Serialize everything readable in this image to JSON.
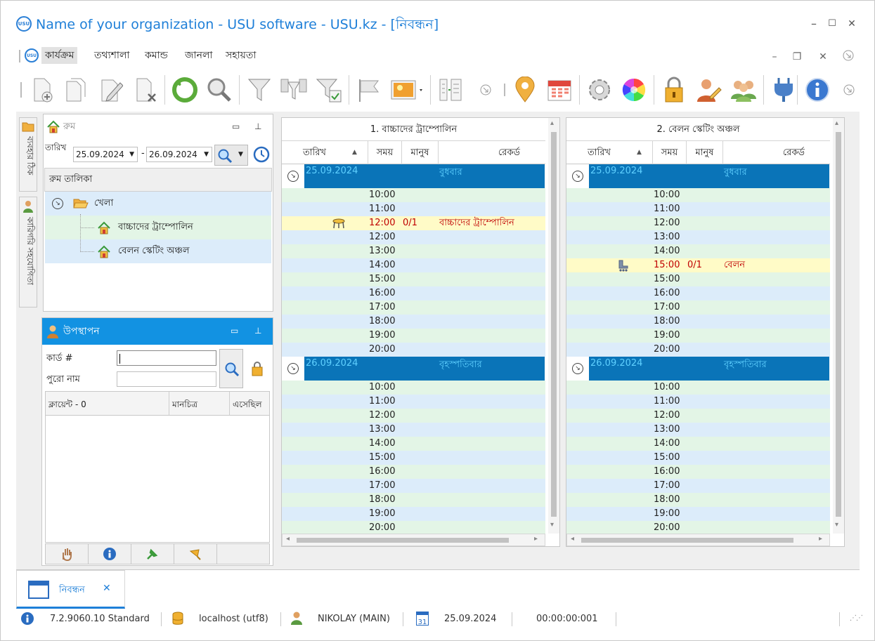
{
  "window": {
    "logo_text": "USU",
    "title": "Name of your organization - USU software - USU.kz - [নিবন্ধন]",
    "min_glyph": "–",
    "max_glyph": "☐",
    "close_glyph": "✕"
  },
  "menu": {
    "items": [
      "কার্যক্রম",
      "তথ্যশালা",
      "কমান্ড",
      "জানলা",
      "সহায়তা"
    ],
    "mdi_min": "–",
    "mdi_restore": "❐",
    "mdi_close": "✕"
  },
  "side_tabs": {
    "list_label": "ব্যবহার ঠিক",
    "staff_label": "কারিগরি সহযোগিতা"
  },
  "room_panel": {
    "title": "রুম",
    "date_label": "তারিখ",
    "date_from": "25.09.2024",
    "date_dash": "-",
    "date_to": "26.09.2024",
    "list_header": "রুম তালিকা",
    "tree": {
      "root": "খেলা",
      "children": [
        "বাচ্চাদের ট্রাম্পোলিন",
        "বেলন স্কেটিং অঞ্চল"
      ]
    }
  },
  "attendance_panel": {
    "title": "উপস্থাপন",
    "card_label": "কার্ড #",
    "card_value": "",
    "name_label": "পুরো নাম",
    "name_value": "",
    "col_client": "ক্লায়েন্ট - 0",
    "col_photo": "মানচিত্র",
    "col_came": "এসেছিল"
  },
  "grid_columns": {
    "date": "তারিখ",
    "time": "সময়",
    "people": "মানুষ",
    "record": "রেকর্ড"
  },
  "schedules": [
    {
      "title": "1. বাচ্চাদের ট্রাম্পোলিন",
      "days": [
        {
          "date": "25.09.2024",
          "weekday": "বুধবার",
          "slots": [
            {
              "time": "10:00"
            },
            {
              "time": "11:00"
            },
            {
              "time": "12:00",
              "people": "0/1",
              "record": "বাচ্চাদের ট্রাম্পোলিন",
              "icon": "trampoline-icon"
            },
            {
              "time": "12:00"
            },
            {
              "time": "13:00"
            },
            {
              "time": "14:00"
            },
            {
              "time": "15:00"
            },
            {
              "time": "16:00"
            },
            {
              "time": "17:00"
            },
            {
              "time": "18:00"
            },
            {
              "time": "19:00"
            },
            {
              "time": "20:00"
            }
          ]
        },
        {
          "date": "26.09.2024",
          "weekday": "বৃহস্পতিবার",
          "slots": [
            {
              "time": "10:00"
            },
            {
              "time": "11:00"
            },
            {
              "time": "12:00"
            },
            {
              "time": "13:00"
            },
            {
              "time": "14:00"
            },
            {
              "time": "15:00"
            },
            {
              "time": "16:00"
            },
            {
              "time": "17:00"
            },
            {
              "time": "18:00"
            },
            {
              "time": "19:00"
            },
            {
              "time": "20:00"
            }
          ]
        }
      ]
    },
    {
      "title": "2. বেলন স্কেটিং অঞ্চল",
      "days": [
        {
          "date": "25.09.2024",
          "weekday": "বুধবার",
          "slots": [
            {
              "time": "10:00"
            },
            {
              "time": "11:00"
            },
            {
              "time": "12:00"
            },
            {
              "time": "13:00"
            },
            {
              "time": "14:00"
            },
            {
              "time": "15:00",
              "people": "0/1",
              "record": "বেলন",
              "icon": "roller-skate-icon"
            },
            {
              "time": "15:00"
            },
            {
              "time": "16:00"
            },
            {
              "time": "17:00"
            },
            {
              "time": "18:00"
            },
            {
              "time": "19:00"
            },
            {
              "time": "20:00"
            }
          ]
        },
        {
          "date": "26.09.2024",
          "weekday": "বৃহস্পতিবার",
          "slots": [
            {
              "time": "10:00"
            },
            {
              "time": "11:00"
            },
            {
              "time": "12:00"
            },
            {
              "time": "13:00"
            },
            {
              "time": "14:00"
            },
            {
              "time": "15:00"
            },
            {
              "time": "16:00"
            },
            {
              "time": "17:00"
            },
            {
              "time": "18:00"
            },
            {
              "time": "19:00"
            },
            {
              "time": "20:00"
            }
          ]
        }
      ]
    }
  ],
  "doc_tab": {
    "label": "নিবন্ধন",
    "close": "✕"
  },
  "status": {
    "version": "7.2.9060.10 Standard",
    "server": "localhost (utf8)",
    "user": "NIKOLAY (MAIN)",
    "calendar_day": "31",
    "date": "25.09.2024",
    "timer": "00:00:00:001"
  },
  "colors": {
    "accent": "#1e7fd8",
    "day_header": "#0a74b8",
    "day_text": "#5fd0ff",
    "row_green": "#e3f5e6",
    "row_blue": "#dcecfa",
    "highlight": "#fffbc7",
    "record_text": "#c00000"
  }
}
